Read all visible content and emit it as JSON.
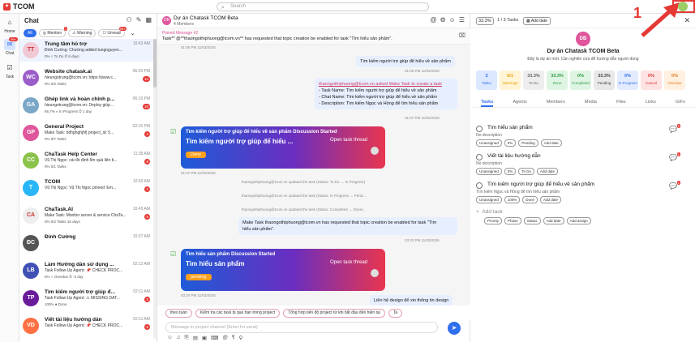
{
  "app": {
    "name": "TCOM",
    "search_placeholder": "Search"
  },
  "rail": [
    {
      "label": "Home",
      "icon": "home-icon",
      "glyph": "⌂"
    },
    {
      "label": "Chat",
      "icon": "chat-icon",
      "glyph": "✉",
      "badge": "99+"
    },
    {
      "label": "Task",
      "icon": "task-icon",
      "glyph": "☑"
    }
  ],
  "chatlist": {
    "title": "Chat",
    "filters": [
      {
        "label": "All"
      },
      {
        "label": "Mention",
        "badge": "7"
      },
      {
        "label": "Warning"
      },
      {
        "label": "Unread",
        "badge": "99+"
      }
    ],
    "conversations": [
      {
        "initials": "TT",
        "color": "#f1c9d5",
        "name": "Trung tâm hỗ trợ",
        "time": "10:43 AM",
        "msg": "Đinh Cường: Chường added tungnguyen...",
        "meta": "0%  ○ To Do  ⏱ 6 days",
        "badge": ""
      },
      {
        "initials": "WC",
        "color": "#9b5ec9",
        "name": "Website chatask.ai",
        "time": "06:29 PM",
        "msg": "hieungotrung@tcom.vn: https://www.c...",
        "meta": "0%  0/2 Tasks",
        "badge": "14"
      },
      {
        "initials": "GA",
        "color": "#7aa7c7",
        "name": "Ghép link và hoàn chỉnh p...",
        "time": "06:19 PM",
        "msg": "hieungotrung@tcom.vn: Deploy giúp...",
        "meta": "66.7%  ◐ In Progress  ⏱ 1 day",
        "badge": "19"
      },
      {
        "initials": "GP",
        "color": "#e0559b",
        "name": "General Project",
        "time": "02:15 PM",
        "msg": "Make Task: hdhghghjhfj project_id: 5...",
        "meta": "0%  0/7 Tasks",
        "badge": "4"
      },
      {
        "initials": "CC",
        "color": "#8bc34a",
        "name": "ChaTask Help Center",
        "time": "11:35 AM",
        "msg": "Vũ Thị Ngọc: cái đó định lên quả liên b...",
        "meta": "0%  0/1 Tasks",
        "badge": "8"
      },
      {
        "initials": "T",
        "color": "#29b6f6",
        "name": "TCOM",
        "time": "10:50 AM",
        "msg": "Vũ Thị Ngọc: Vũ Thị Ngọc pinned 'Em...",
        "meta": "",
        "badge": "2"
      },
      {
        "initials": "CA",
        "color": "#eeeeee",
        "name": "ChaTask.AI",
        "time": "10:45 AM",
        "msg": "Make Task: Monitor server & service ChaTa...",
        "meta": "0%  0/2 Tasks  16 days",
        "badge": "8"
      },
      {
        "initials": "ĐC",
        "color": "#555555",
        "name": "Đinh Cường",
        "time": "10:37 AM",
        "msg": "",
        "meta": "",
        "badge": ""
      },
      {
        "initials": "LB",
        "color": "#3f51b5",
        "name": "Làm Hướng dẫn sử dụng ...",
        "time": "02:12 AM",
        "msg": "Task Follow-Up Agent: 📌 CHECK PROC...",
        "meta": "0%  ○ Overdue  ⏱ -3 day",
        "badge": ""
      },
      {
        "initials": "TP",
        "color": "#6a1b9a",
        "name": "Tìm kiếm người trợ giúp đ...",
        "time": "02:11 AM",
        "msg": "Task Follow-Up Agent: ⚠ MISSING DAT...",
        "meta": "100%  ● Done",
        "badge": "5"
      },
      {
        "initials": "VD",
        "color": "#ff7043",
        "name": "Viết tài liệu hướng dẫn",
        "time": "02:11 AM",
        "msg": "Task Follow-Up Agent: 📌 CHECK PROC...",
        "meta": "",
        "badge": "5"
      }
    ]
  },
  "conversation": {
    "avatar": "DB",
    "title": "Dự án Chatask TCOM Beta",
    "members": "4 Members",
    "pinned_label": "Pinned Message #2",
    "pinned_text": "Task** @**thaongothiphuong@tcom.vn** has requested that topic creation be enabled for task \"Tìm hiểu sản phẩm\".",
    "t1": "01:05 PM 11/03/2026",
    "b1": "Tìm kiếm người trợ giúp để hiểu về sản phẩm",
    "t2": "01:06 PM 11/03/2026",
    "b2_lines": [
      "thaongothiphuong@tcom.vn asked Make Task to create a task",
      "- Task Name: Tìm kiếm người trợ giúp để hiểu về sản phẩm",
      "- Chat Name: Tìm kiếm người trợ giúp để hiểu về sản phẩm",
      "- Description: Tìm kiếm Ngọc và Hồng để tìm hiểu sản phẩm"
    ],
    "t3": "01:07 PM 11/03/2026",
    "card1": {
      "header": "Tìm kiếm người trợ giúp để hiểu về sản phẩm Discussion Started",
      "title": "Tìm kiếm người trợ giúp để hiểu ...",
      "open": "Open task thread",
      "status": "Done"
    },
    "t4": "01:07 PM 11/03/2026",
    "sys1": "thaongothiphuong@tcom.vn updated the task (Status: To Do → In Progress)",
    "sys2": "thaongothiphuong@tcom.vn updated the task (Status: In Progress → Pend...",
    "sys3": "thaongothiphuong@tcom.vn updated the task (Status: Completed → Done)",
    "b3_lines": [
      "Make Task thaongothiphuong@tcom.vn has requested that topic creation be enabled for task \"Tìm",
      "hiểu sản phẩm\"."
    ],
    "t5": "03:20 PM 11/03/2026",
    "card2": {
      "header": "Tìm hiểu sản phẩm Discussion Started",
      "title": "Tìm hiểu sản phẩm",
      "open": "Open task thread",
      "status": "pending"
    },
    "t6": "03:20 PM 11/03/2026",
    "b4": "Liên hệ design để xin thông tin design",
    "suggestions": [
      "theo tuần",
      "Kiểm tra các task bị quá hạn trong project",
      "Tổng hợp tiến độ project từ khi bắt đầu đến hiện tại",
      "Ta"
    ],
    "composer_placeholder": "Message in project channel (Enter for send)"
  },
  "panel": {
    "pct": "33.3%",
    "tasks_count": "1 / 3 Tasks",
    "add_date": "Add date",
    "project_initials": "DB",
    "project_name": "Dự án Chatask TCOM Beta",
    "project_desc": "Đây là dự án mới. Cần nghiên cứu để hướng dẫn người dùng",
    "stats": [
      {
        "v": "3",
        "l": "Tasks",
        "bg": "#dbe8ff",
        "c": "#2f6fed"
      },
      {
        "v": "0/1",
        "l": "Warnings",
        "bg": "#fff4d6",
        "c": "#e6a100"
      },
      {
        "v": "33.3%",
        "l": "To Do",
        "bg": "#eeeeee",
        "c": "#666"
      },
      {
        "v": "33.3%",
        "l": "Done",
        "bg": "#dff5e3",
        "c": "#2e9b46"
      },
      {
        "v": "0%",
        "l": "Completed",
        "bg": "#dff5e3",
        "c": "#2e9b46"
      },
      {
        "v": "33.3%",
        "l": "Pending",
        "bg": "#e8e8e8",
        "c": "#444"
      },
      {
        "v": "0%",
        "l": "In Progress",
        "bg": "#e3ecff",
        "c": "#2f6fed"
      },
      {
        "v": "0%",
        "l": "Cancel",
        "bg": "#ffe3e3",
        "c": "#d33"
      },
      {
        "v": "0%",
        "l": "Overdue",
        "bg": "#fff0e0",
        "c": "#e67e22"
      }
    ],
    "tabs": [
      "Tasks",
      "Agents",
      "Members",
      "Media",
      "Files",
      "Links",
      "GIFs"
    ],
    "tasks": [
      {
        "name": "Tìm hiểu sản phẩm",
        "desc": "No description",
        "tags": [
          "Unassigned",
          "0%",
          "Pending",
          "Add date"
        ],
        "chat_n": "2"
      },
      {
        "name": "Viết tài liệu hướng dẫn",
        "desc": "No description",
        "tags": [
          "Unassigned",
          "0%",
          "To Do",
          "Add date"
        ],
        "chat_n": "1"
      },
      {
        "name": "Tìm kiếm người trợ giúp để hiểu về sản phẩm",
        "desc": "Tìm kiếm Ngọc và Hồng để tìm hiểu sản phẩm",
        "tags": [
          "Unassigned",
          "100%",
          "Done",
          "Add date"
        ],
        "chat_n": "1"
      }
    ],
    "add_task": "Add task",
    "add_task_tags": [
      "Priority",
      "Phase",
      "Status",
      "Add date",
      "Add assign"
    ]
  },
  "annotation": {
    "number": "1"
  }
}
